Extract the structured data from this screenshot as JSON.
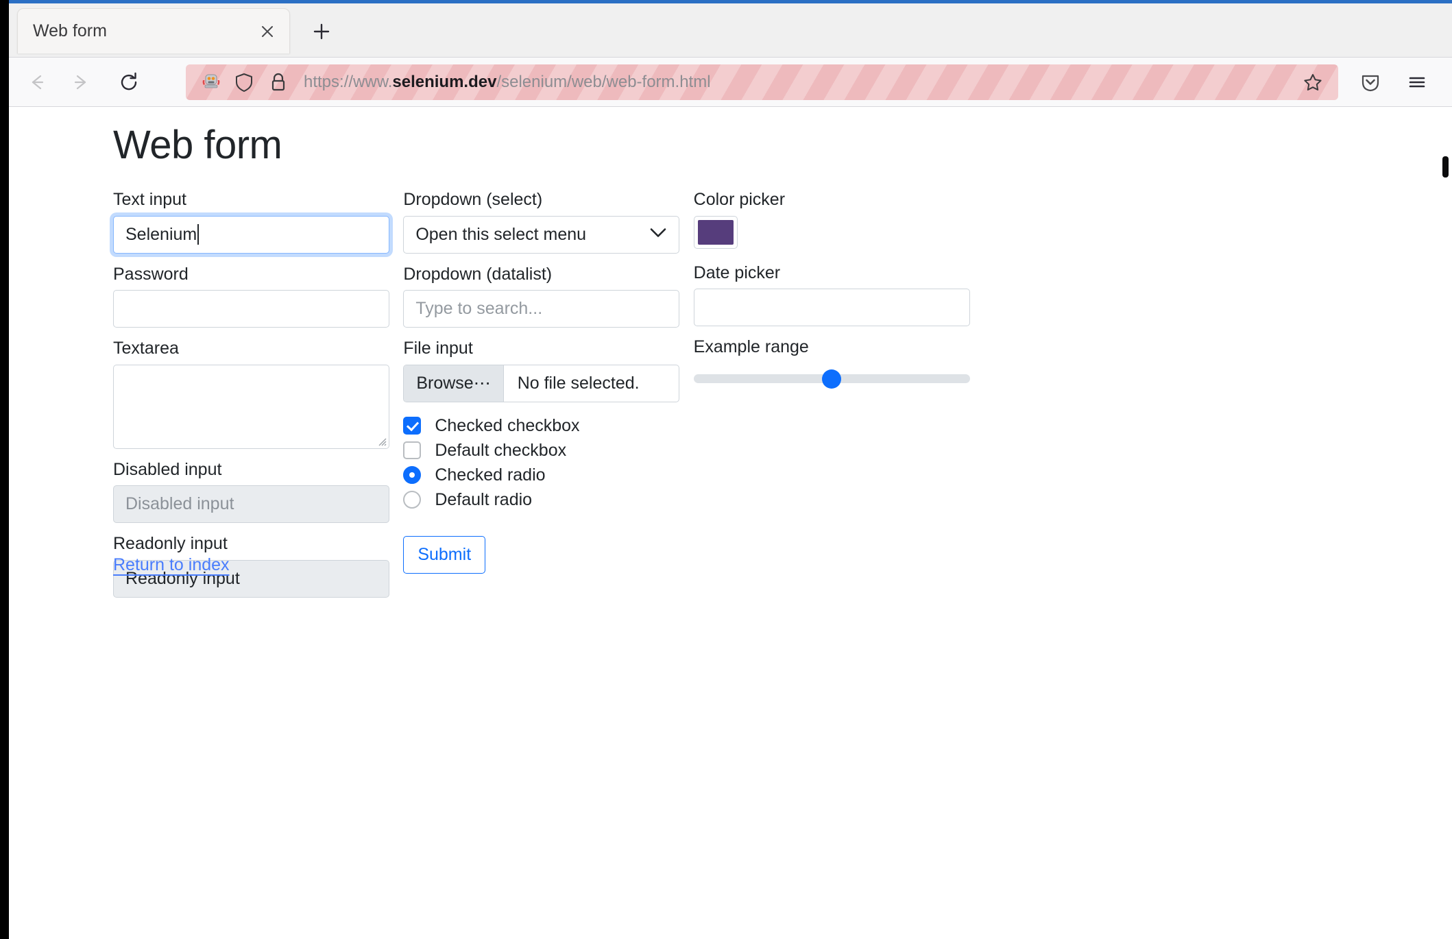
{
  "browser": {
    "tab": {
      "title": "Web form",
      "close_label": "×"
    },
    "new_tab_label": "+",
    "nav": {
      "back_label": "←",
      "forward_label": "→",
      "reload_label": "⟳"
    },
    "urlbar": {
      "robot_icon": "robot-automation-icon",
      "shield_icon": "shield-icon",
      "lock_icon": "lock-icon",
      "url_prefix": "https://www.",
      "url_host": "selenium.dev",
      "url_path": "/selenium/web/web-form.html",
      "star_icon": "star-bookmark-icon"
    },
    "toolbar": {
      "pocket_icon": "pocket-save-icon",
      "menu_icon": "hamburger-menu-icon"
    },
    "accent_color": "#2b6fc4",
    "urlbar_background": "#f3cdcf"
  },
  "page": {
    "title": "Web form",
    "columns": [
      {
        "fields": [
          {
            "label": "Text input",
            "value": "Selenium",
            "state": "focused",
            "type": "text"
          },
          {
            "label": "Password",
            "value": "",
            "state": "normal",
            "type": "password"
          },
          {
            "label": "Textarea",
            "value": "",
            "state": "normal",
            "type": "textarea"
          },
          {
            "label": "Disabled input",
            "value": "Disabled input",
            "state": "disabled",
            "type": "text"
          },
          {
            "label": "Readonly input",
            "value": "Readonly input",
            "state": "readonly",
            "type": "text"
          }
        ]
      },
      {
        "fields": [
          {
            "label": "Dropdown (select)",
            "value": "Open this select menu",
            "state": "normal",
            "type": "select"
          },
          {
            "label": "Dropdown (datalist)",
            "value": "",
            "placeholder": "Type to search...",
            "state": "normal",
            "type": "datalist"
          },
          {
            "label": "File input",
            "button_label": "Browse⋯",
            "value": "No file selected.",
            "state": "normal",
            "type": "file"
          }
        ],
        "checks": [
          {
            "label": "Checked checkbox",
            "type": "checkbox",
            "checked": true
          },
          {
            "label": "Default checkbox",
            "type": "checkbox",
            "checked": false
          },
          {
            "label": "Checked radio",
            "type": "radio",
            "checked": true
          },
          {
            "label": "Default radio",
            "type": "radio",
            "checked": false
          }
        ],
        "submit_label": "Submit"
      },
      {
        "fields": [
          {
            "label": "Color picker",
            "value": "#563d7c",
            "state": "normal",
            "type": "color"
          },
          {
            "label": "Date picker",
            "value": "",
            "state": "normal",
            "type": "date"
          },
          {
            "label": "Example range",
            "value": 5,
            "min": 0,
            "max": 10,
            "percent": 50,
            "state": "normal",
            "type": "range"
          }
        ]
      }
    ],
    "return_link": "Return to index",
    "link_color": "#4a7dfc",
    "accent_color": "#0d6efd"
  }
}
